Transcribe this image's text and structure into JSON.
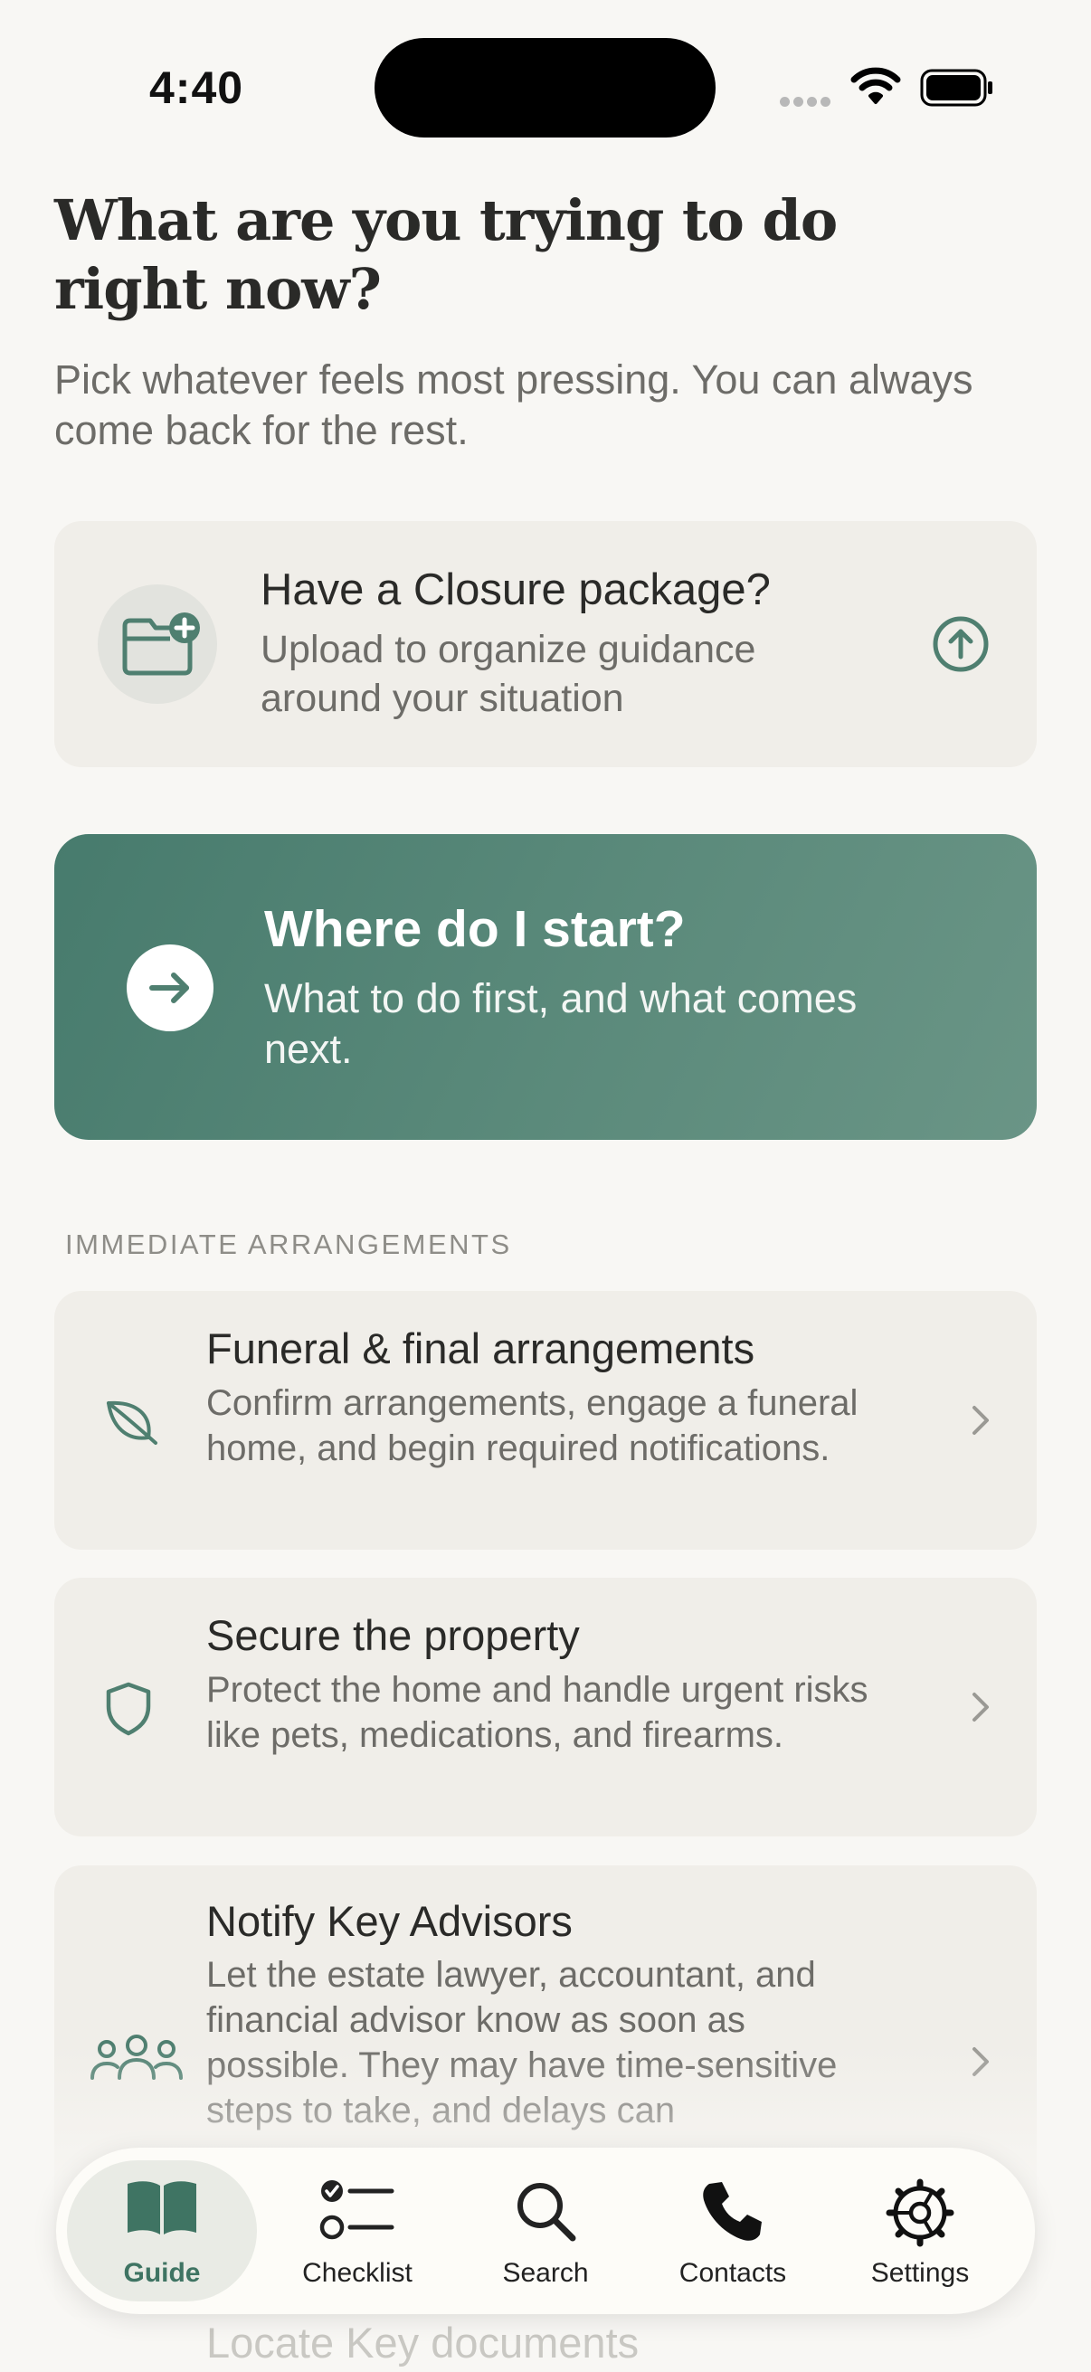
{
  "status_bar": {
    "time": "4:40"
  },
  "header": {
    "title": "What are you trying to do right now?",
    "subtitle": "Pick whatever feels most pressing. You can always come back for the rest."
  },
  "upload_card": {
    "title": "Have a Closure package?",
    "subtitle": "Upload to organize guidance around your situation",
    "icon": "folder-add-icon",
    "action_icon": "upload-arrow-icon"
  },
  "start_card": {
    "title": "Where do I start?",
    "subtitle": "What to do first, and what comes next.",
    "icon": "arrow-right-icon"
  },
  "section": {
    "label": "IMMEDIATE ARRANGEMENTS",
    "items": [
      {
        "title": "Funeral & final arrangements",
        "description": "Confirm arrangements, engage a funeral home, and begin required notifications.",
        "icon": "leaf-icon"
      },
      {
        "title": "Secure the property",
        "description": "Protect the home and handle urgent risks like pets, medications, and firearms.",
        "icon": "shield-icon"
      },
      {
        "title": "Notify Key Advisors",
        "description": "Let the estate lawyer, accountant, and financial advisor know as soon as possible. They may have time-sensitive steps to take, and delays can",
        "icon": "people-icon"
      },
      {
        "title": "Locate Key documents"
      }
    ]
  },
  "tab_bar": {
    "tabs": [
      {
        "label": "Guide",
        "icon": "book-icon",
        "active": true
      },
      {
        "label": "Checklist",
        "icon": "checklist-icon"
      },
      {
        "label": "Search",
        "icon": "search-icon"
      },
      {
        "label": "Contacts",
        "icon": "phone-icon"
      },
      {
        "label": "Settings",
        "icon": "gear-icon"
      }
    ]
  },
  "colors": {
    "accent": "#4f7f70",
    "background": "#f8f7f4",
    "card": "#f0eee9"
  }
}
